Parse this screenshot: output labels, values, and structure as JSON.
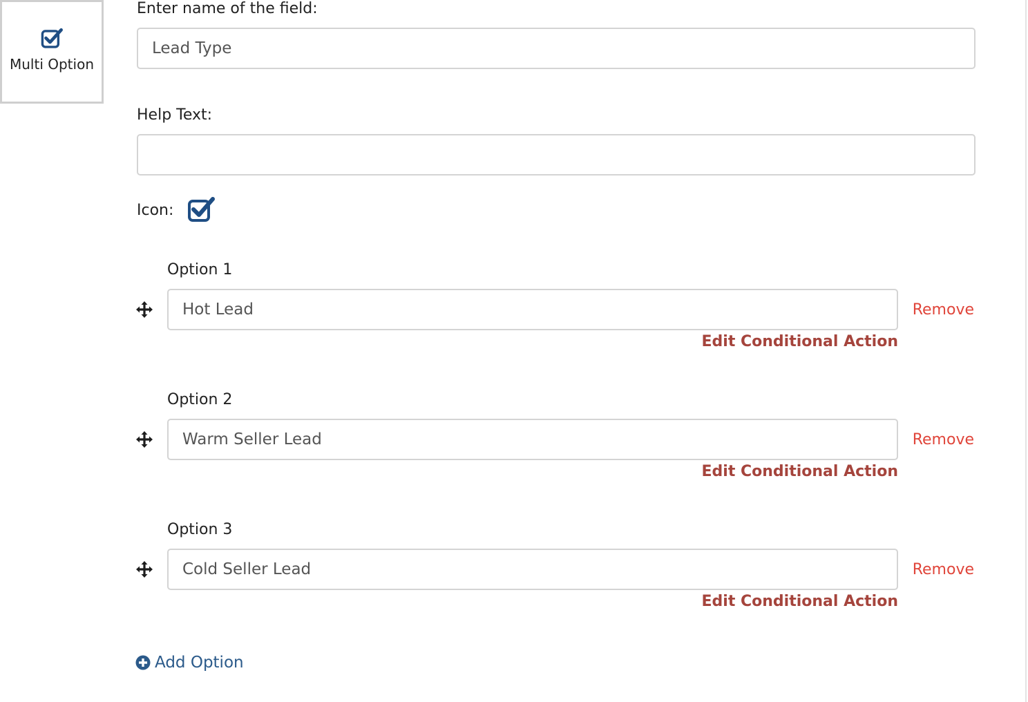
{
  "field_type": {
    "label": "Multi Option",
    "icon": "checkbox-checked-icon",
    "accent": "#1f4e84"
  },
  "form": {
    "name_label": "Enter name of the field:",
    "name_value": "Lead Type",
    "help_label": "Help Text:",
    "help_value": "",
    "icon_label": "Icon:",
    "icon_value": "checkbox-checked-icon"
  },
  "options": [
    {
      "label": "Option 1",
      "value": "Hot Lead",
      "remove": "Remove",
      "conditional": "Edit Conditional Action"
    },
    {
      "label": "Option 2",
      "value": "Warm Seller Lead",
      "remove": "Remove",
      "conditional": "Edit Conditional Action"
    },
    {
      "label": "Option 3",
      "value": "Cold Seller Lead",
      "remove": "Remove",
      "conditional": "Edit Conditional Action"
    }
  ],
  "add_option_label": "Add Option",
  "colors": {
    "remove": "#e0453a",
    "conditional": "#a5443c",
    "link": "#2b5a8a"
  }
}
